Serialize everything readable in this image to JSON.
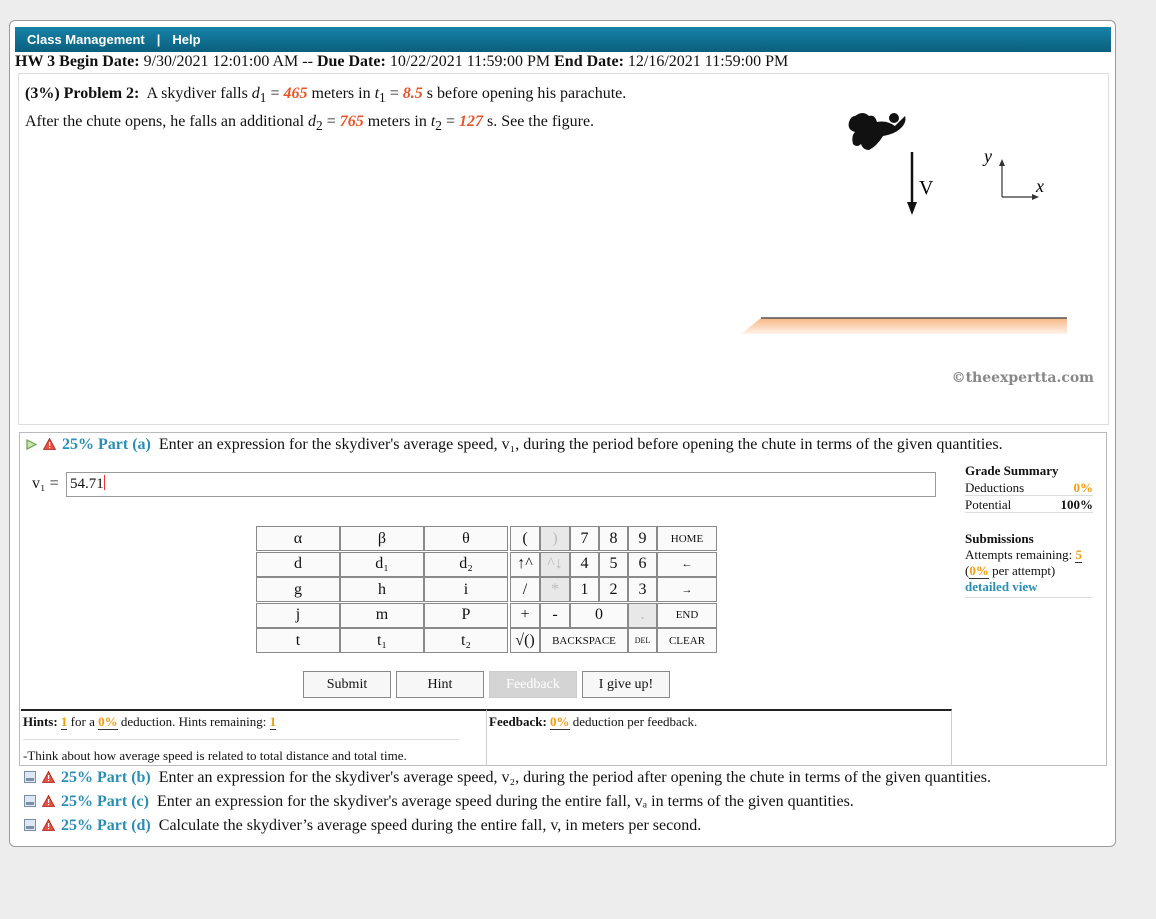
{
  "nav": {
    "class_management": "Class Management",
    "separator": "|",
    "help": "Help"
  },
  "hw": {
    "title": "HW 3",
    "begin_label": "Begin Date:",
    "begin_value": "9/30/2021 12:01:00 AM --",
    "due_label": "Due Date:",
    "due_value": "10/22/2021 11:59:00 PM",
    "end_label": "End Date:",
    "end_value": "12/16/2021 11:59:00 PM"
  },
  "problem": {
    "weight": "(3%)",
    "label": "Problem 2:",
    "line1_pre": "A skydiver falls",
    "d1": "465",
    "line1_mid": "meters in",
    "t1": "8.5",
    "line1_post": "s before opening his parachute.",
    "line2_pre": "After the chute opens, he falls an additional",
    "d2": "765",
    "line2_mid": "meters in",
    "t2": "127",
    "line2_post": "s. See the figure."
  },
  "figure": {
    "velocity_label": "V",
    "y_label": "y",
    "x_label": "x",
    "copyright": "©theexpertta.com"
  },
  "part_a": {
    "percent": "25% Part (a)",
    "text": "Enter an expression for the skydiver's average speed, v₁, during the period before opening the chute in terms of the given quantities.",
    "input_label": "v₁ =",
    "input_value": "54.71"
  },
  "keypad": {
    "vars": [
      [
        "α",
        "β",
        "θ"
      ],
      [
        "d",
        "d₁",
        "d₂"
      ],
      [
        "g",
        "h",
        "i"
      ],
      [
        "j",
        "m",
        "P"
      ],
      [
        "t",
        "t₁",
        "t₂"
      ]
    ],
    "ops": [
      "(",
      ")",
      "↑^",
      "^↓",
      "/",
      "*",
      "+",
      "-",
      "√()"
    ],
    "digits": [
      "7",
      "8",
      "9",
      "4",
      "5",
      "6",
      "1",
      "2",
      "3",
      "0",
      "."
    ],
    "specials": [
      "HOME",
      "←",
      "→",
      "END",
      "BACKSPACE",
      "DEL",
      "CLEAR"
    ]
  },
  "buttons": {
    "submit": "Submit",
    "hint": "Hint",
    "feedback": "Feedback",
    "giveup": "I give up!"
  },
  "grade": {
    "title": "Grade Summary",
    "deductions_label": "Deductions",
    "deductions_value": "0%",
    "potential_label": "Potential",
    "potential_value": "100%",
    "submissions_title": "Submissions",
    "attempts_label": "Attempts remaining:",
    "attempts_value": "5",
    "per_attempt_value": "0%",
    "per_attempt_label": "per attempt)",
    "detailed": "detailed view"
  },
  "hints": {
    "label": "Hints:",
    "count": "1",
    "for_a": "for a",
    "deduction": "0%",
    "deduction_text": "deduction. Hints remaining:",
    "remaining": "1",
    "text": "-Think about how average speed is related to total distance and total time."
  },
  "feedback": {
    "label": "Feedback:",
    "value": "0%",
    "text": "deduction per feedback."
  },
  "parts": [
    {
      "percent": "25% Part (b)",
      "text": "Enter an expression for the skydiver's average speed, v₂, during the period after opening the chute in terms of the given quantities."
    },
    {
      "percent": "25% Part (c)",
      "text": "Enter an expression for the skydiver's average speed during the entire fall, vₐ in terms of the given quantities."
    },
    {
      "percent": "25% Part (d)",
      "text": "Calculate the skydiver’s average speed during the entire fall, v, in meters per second."
    }
  ]
}
